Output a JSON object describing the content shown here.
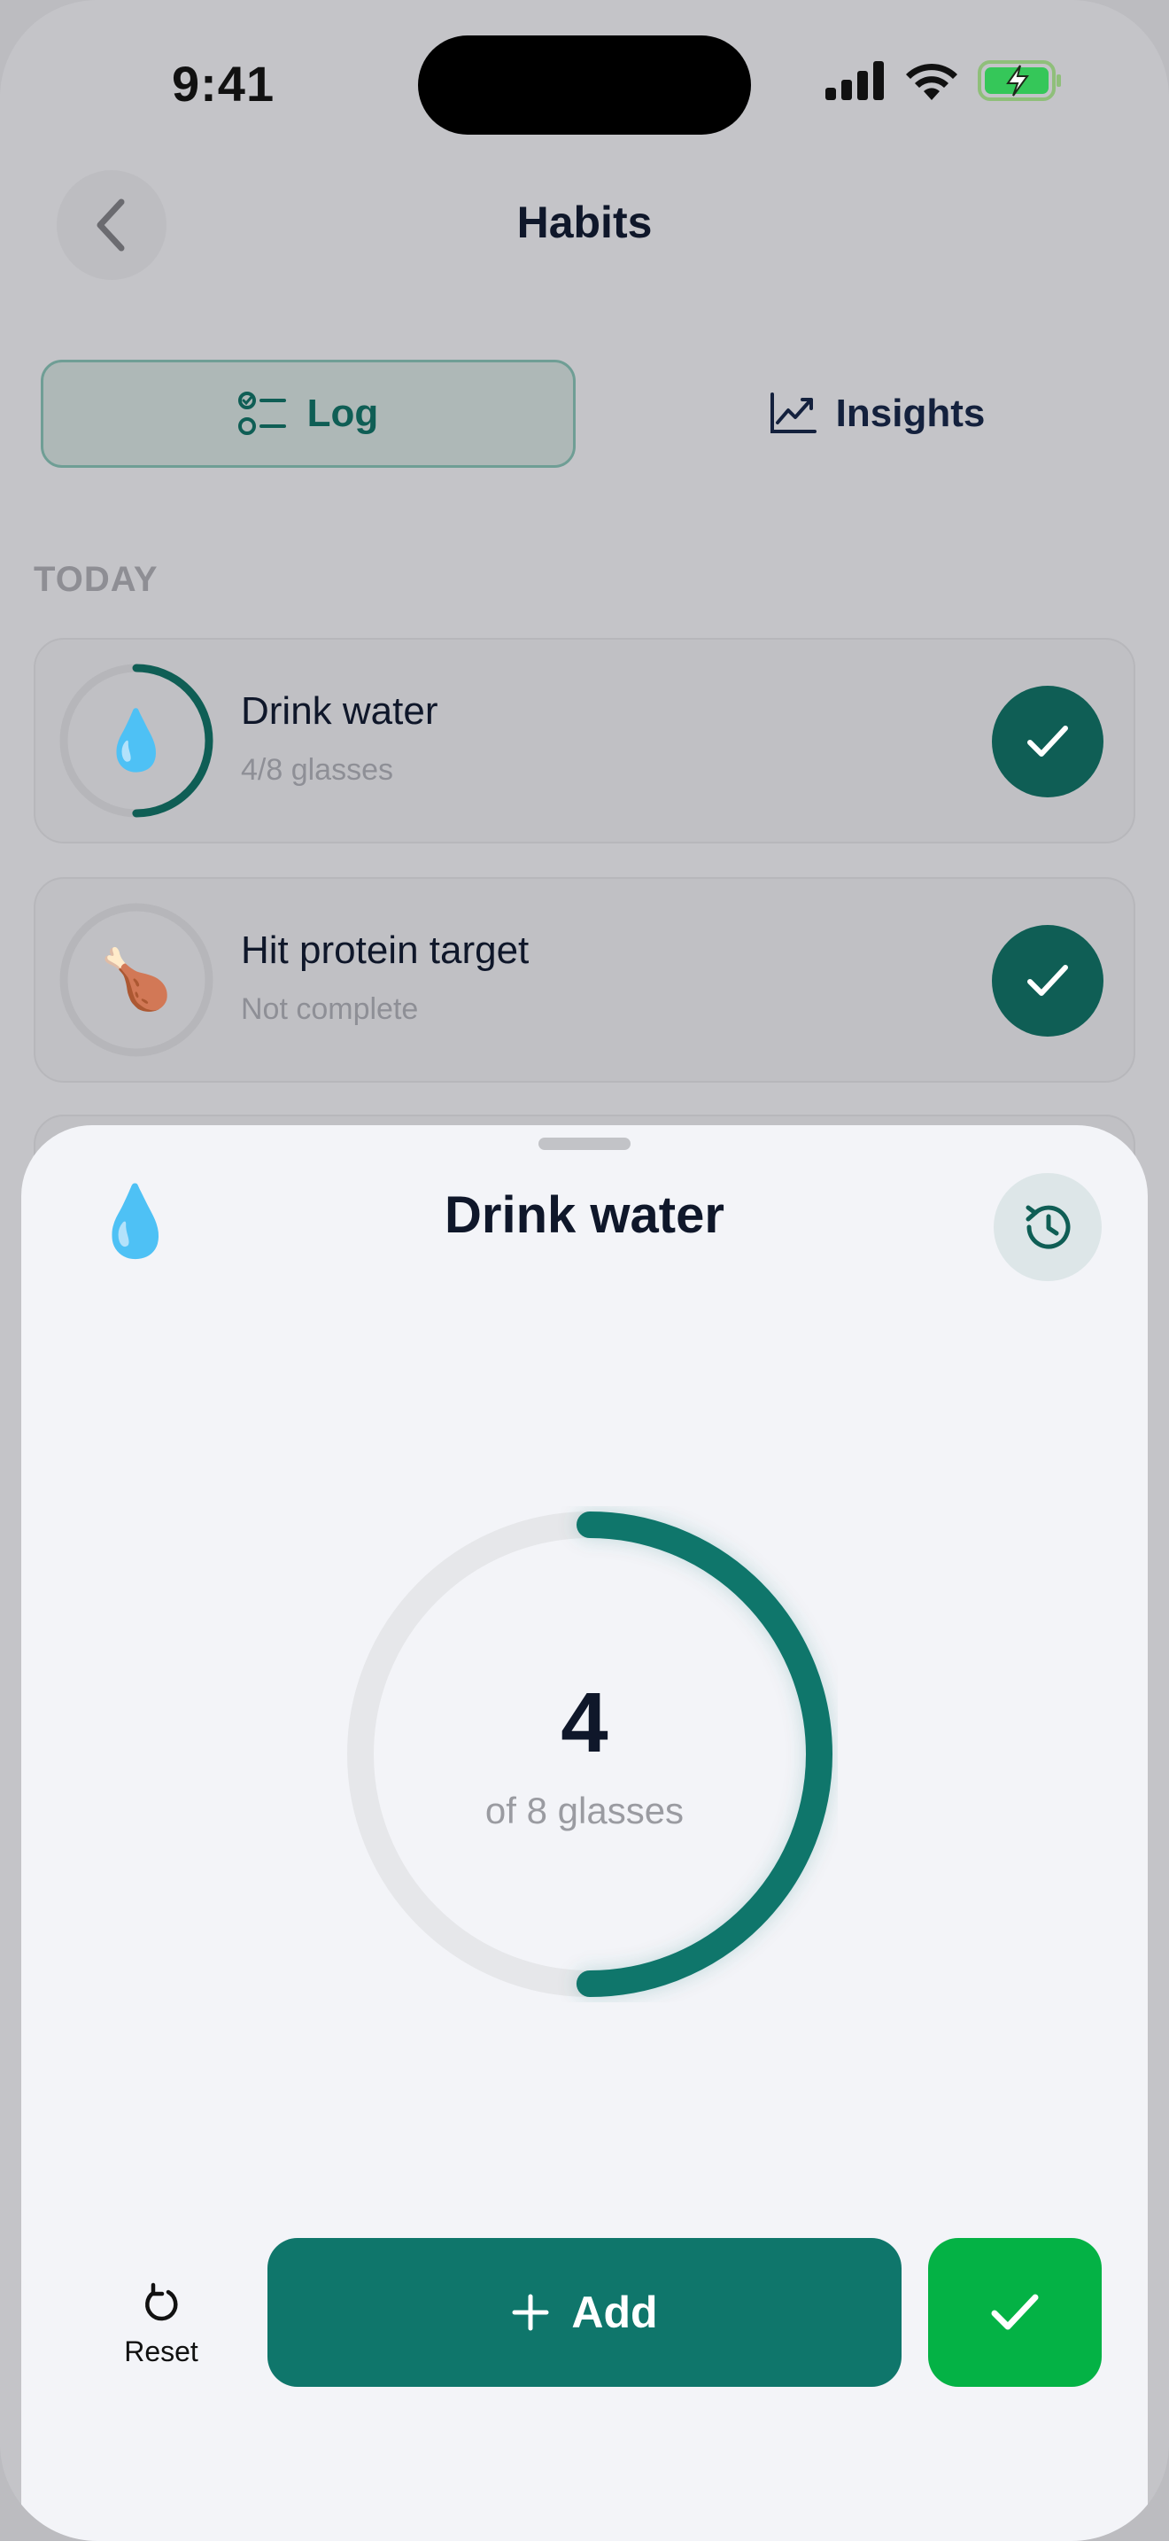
{
  "status_bar": {
    "time": "9:41"
  },
  "header": {
    "title": "Habits"
  },
  "tabs": [
    {
      "label": "Log",
      "icon": "checklist-icon",
      "active": true
    },
    {
      "label": "Insights",
      "icon": "trend-chart-icon",
      "active": false
    }
  ],
  "section": {
    "label": "TODAY"
  },
  "habits": [
    {
      "emoji": "💧",
      "title": "Drink water",
      "subtitle": "4/8 glasses",
      "progress": 0.5
    },
    {
      "emoji": "🍗",
      "title": "Hit protein target",
      "subtitle": "Not complete",
      "progress": 0
    }
  ],
  "sheet": {
    "emoji": "💧",
    "title": "Drink water",
    "count": "4",
    "caption": "of 8 glasses",
    "progress": 0.5,
    "reset_label": "Reset",
    "add_label": "Add"
  },
  "colors": {
    "accent": "#0f766b",
    "done": "#04b245",
    "ring_track": "#e6e7ea"
  }
}
